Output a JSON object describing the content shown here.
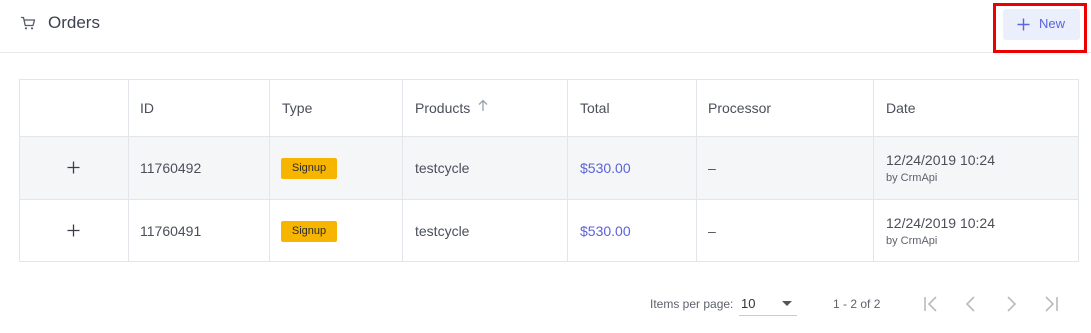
{
  "header": {
    "title": "Orders",
    "cart_icon": "cart-icon",
    "new_button_label": "New"
  },
  "table": {
    "columns": [
      "",
      "ID",
      "Type",
      "Products",
      "Total",
      "Processor",
      "Date"
    ],
    "sorted_column": "Products",
    "rows": [
      {
        "id": "11760492",
        "type": "Signup",
        "products": "testcycle",
        "total": "$530.00",
        "processor": "–",
        "date": "12/24/2019 10:24",
        "by": "by CrmApi"
      },
      {
        "id": "11760491",
        "type": "Signup",
        "products": "testcycle",
        "total": "$530.00",
        "processor": "–",
        "date": "12/24/2019 10:24",
        "by": "by CrmApi"
      }
    ]
  },
  "pagination": {
    "items_per_page_label": "Items per page:",
    "items_per_page_value": "10",
    "range_label": "1 - 2 of 2"
  },
  "colors": {
    "accent": "#5865e0",
    "badge": "#f7b500",
    "highlight": "#ee0000"
  }
}
